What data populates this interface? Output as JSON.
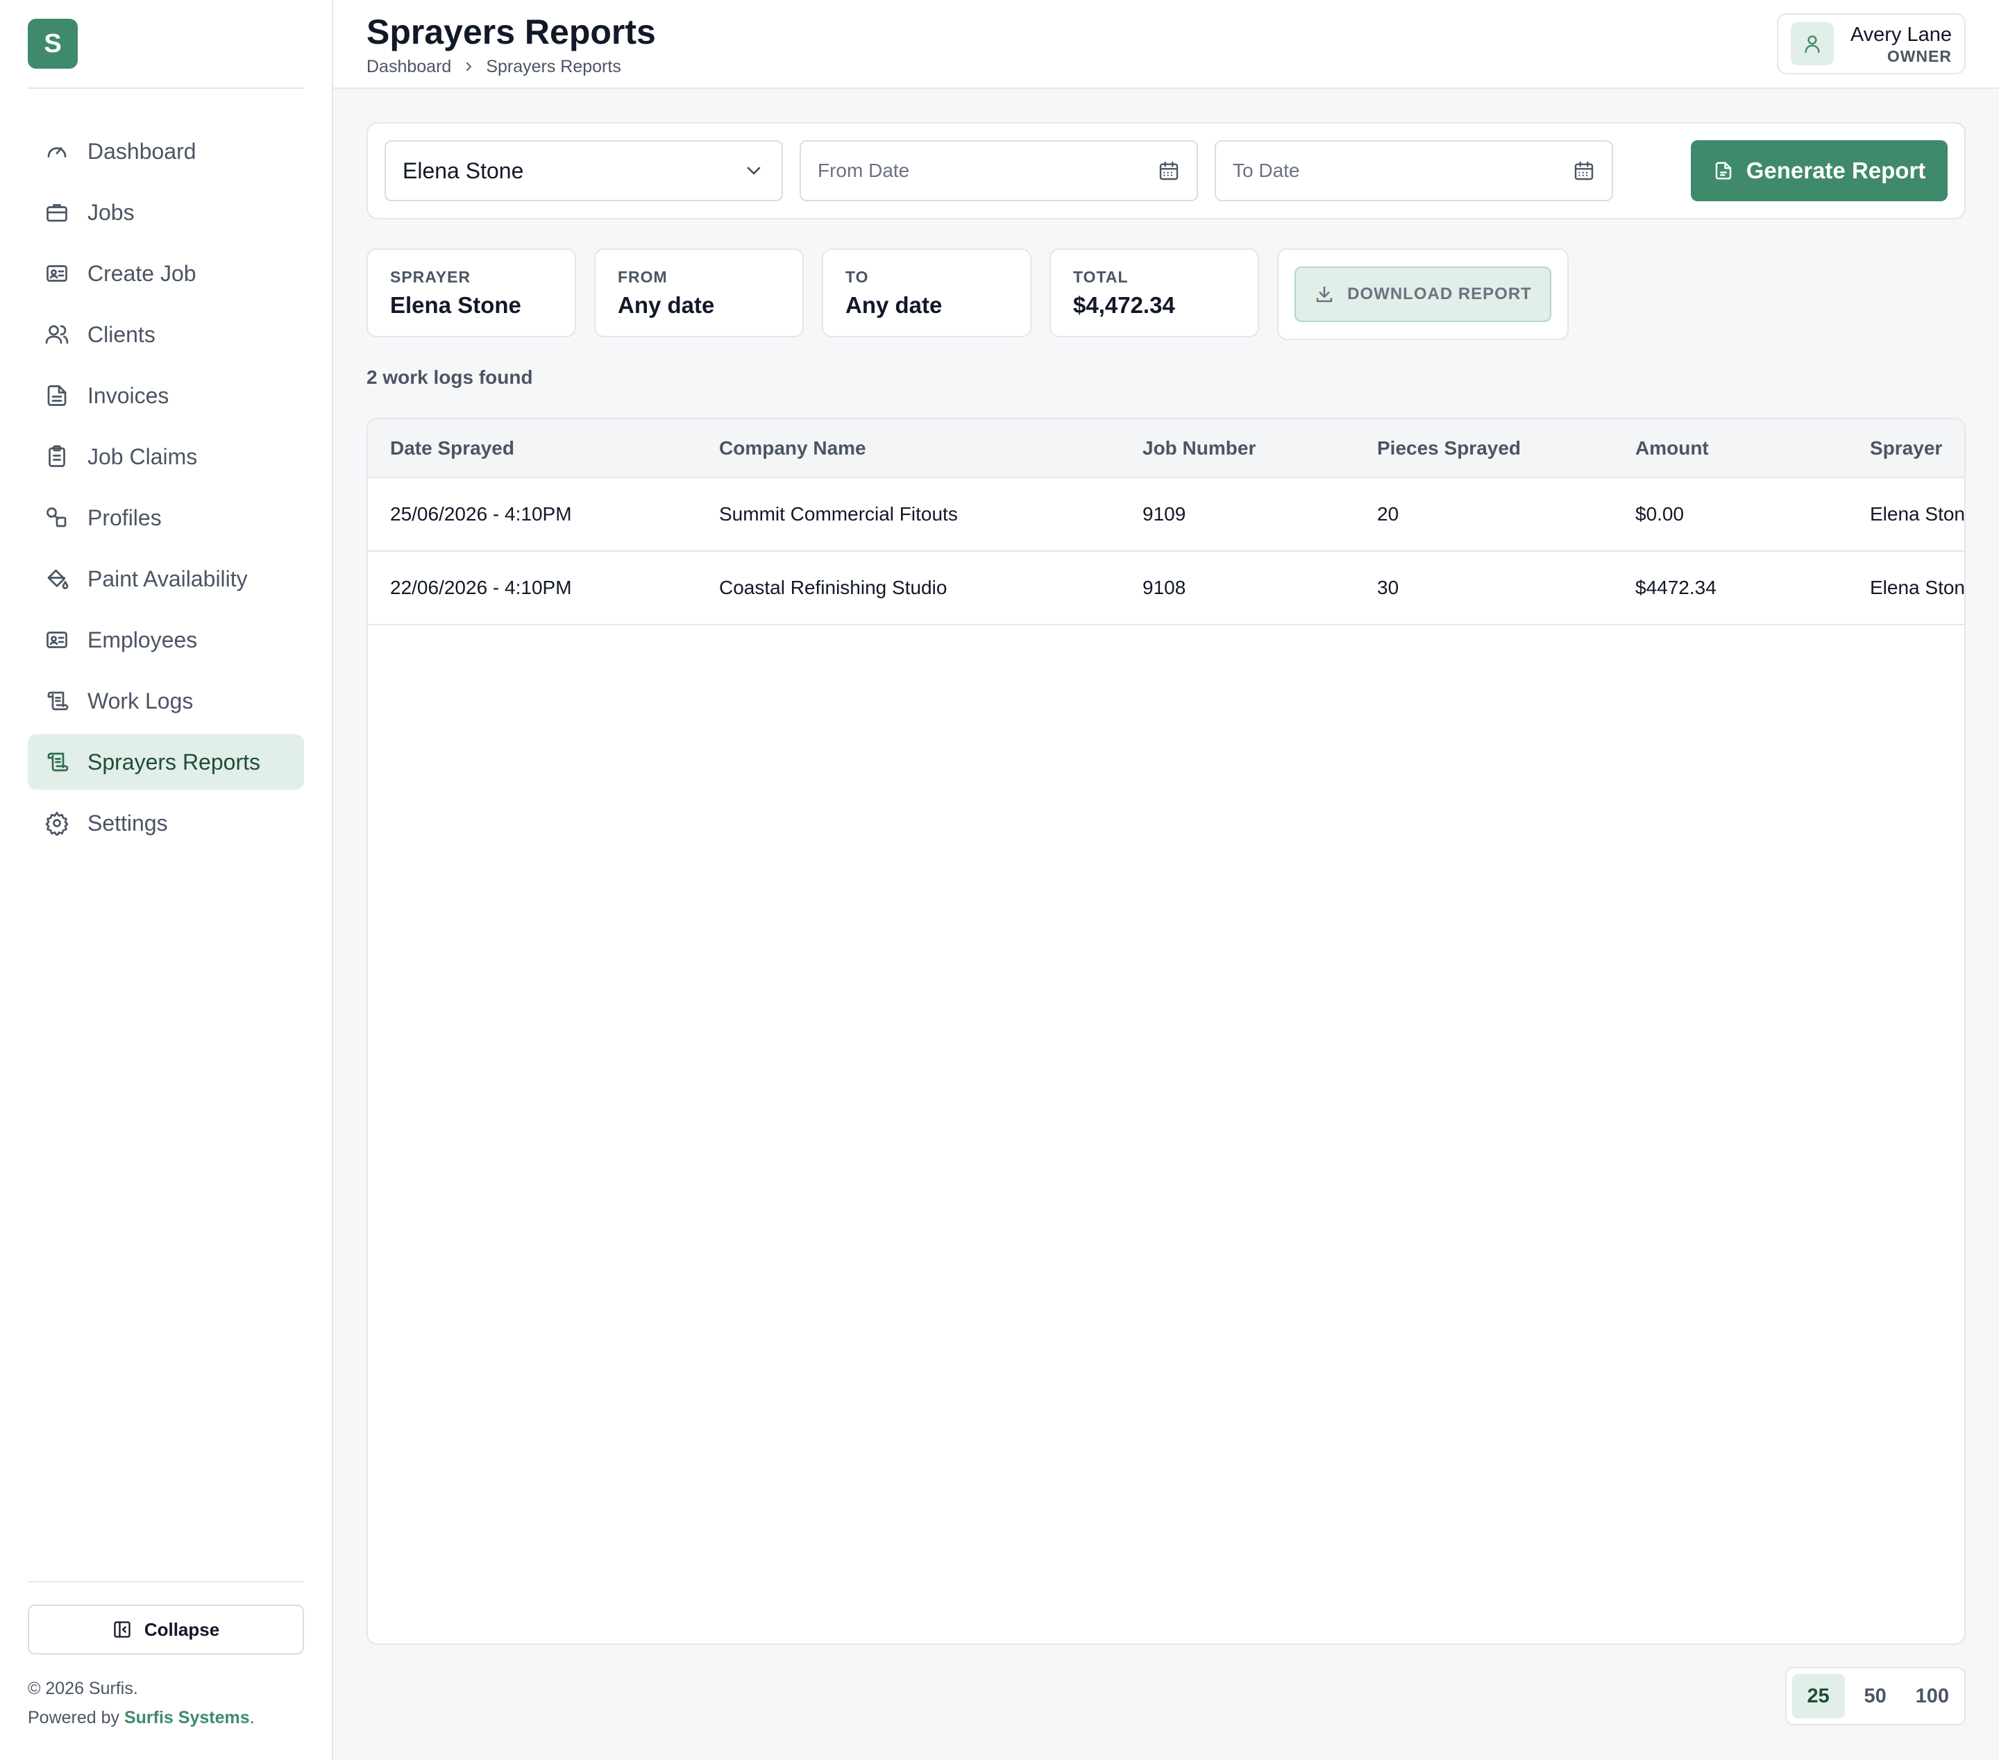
{
  "brand": {
    "logo_letter": "S"
  },
  "sidebar": {
    "items": [
      {
        "label": "Dashboard",
        "icon": "gauge-icon"
      },
      {
        "label": "Jobs",
        "icon": "briefcase-icon"
      },
      {
        "label": "Create Job",
        "icon": "id-card-icon"
      },
      {
        "label": "Clients",
        "icon": "users-icon"
      },
      {
        "label": "Invoices",
        "icon": "file-text-icon"
      },
      {
        "label": "Job Claims",
        "icon": "clipboard-icon"
      },
      {
        "label": "Profiles",
        "icon": "shapes-icon"
      },
      {
        "label": "Paint Availability",
        "icon": "paint-bucket-icon"
      },
      {
        "label": "Employees",
        "icon": "id-card-icon"
      },
      {
        "label": "Work Logs",
        "icon": "scroll-icon"
      },
      {
        "label": "Sprayers Reports",
        "icon": "scroll-icon",
        "active": true
      },
      {
        "label": "Settings",
        "icon": "gear-icon"
      }
    ],
    "collapse_label": "Collapse",
    "copyright": "© 2026 Surfis.",
    "powered_prefix": "Powered by",
    "powered_link": "Surfis Systems",
    "powered_suffix": "."
  },
  "header": {
    "title": "Sprayers Reports",
    "breadcrumb": [
      "Dashboard",
      "Sprayers Reports"
    ],
    "user": {
      "name": "Avery Lane",
      "role": "OWNER"
    }
  },
  "filters": {
    "sprayer_value": "Elena Stone",
    "from_placeholder": "From Date",
    "to_placeholder": "To Date",
    "generate_label": "Generate Report"
  },
  "summary": {
    "sprayer_label": "SPRAYER",
    "sprayer_value": "Elena Stone",
    "from_label": "FROM",
    "from_value": "Any date",
    "to_label": "TO",
    "to_value": "Any date",
    "total_label": "TOTAL",
    "total_value": "$4,472.34",
    "download_label": "DOWNLOAD REPORT"
  },
  "results_count": "2 work logs found",
  "table": {
    "columns": [
      "Date Sprayed",
      "Company Name",
      "Job Number",
      "Pieces Sprayed",
      "Amount",
      "Sprayer"
    ],
    "rows": [
      [
        "25/06/2026 - 4:10PM",
        "Summit Commercial Fitouts",
        "9109",
        "20",
        "$0.00",
        "Elena Stone"
      ],
      [
        "22/06/2026 - 4:10PM",
        "Coastal Refinishing Studio",
        "9108",
        "30",
        "$4472.34",
        "Elena Stone"
      ]
    ]
  },
  "pagination": {
    "options": [
      "25",
      "50",
      "100"
    ],
    "selected": "25"
  },
  "colors": {
    "accent": "#3f8a6b",
    "accent_light": "#e1efe8"
  }
}
